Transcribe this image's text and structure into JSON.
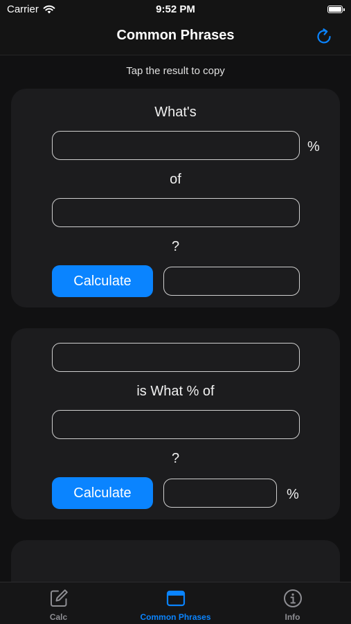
{
  "status_bar": {
    "carrier": "Carrier",
    "time": "9:52 PM"
  },
  "nav": {
    "title": "Common Phrases",
    "refresh_icon": "refresh-icon"
  },
  "hint": "Tap the result to copy",
  "card1": {
    "label_top": "What's",
    "percent_suffix": "%",
    "label_middle": "of",
    "label_question": "?",
    "calculate_label": "Calculate",
    "field_percent_value": "",
    "field_base_value": "",
    "result_value": ""
  },
  "card2": {
    "label_middle": "is What % of",
    "label_question": "?",
    "calculate_label": "Calculate",
    "result_suffix": "%",
    "field_part_value": "",
    "field_whole_value": "",
    "result_value": ""
  },
  "tabs": [
    {
      "label": "Calc",
      "icon": "pencil-square-icon",
      "active": false
    },
    {
      "label": "Common Phrases",
      "icon": "window-icon",
      "active": true
    },
    {
      "label": "Info",
      "icon": "info-circle-icon",
      "active": false
    }
  ],
  "colors": {
    "accent": "#0a84ff",
    "background": "#111112",
    "card": "#1c1c1e",
    "tab_inactive": "#8e8e93"
  }
}
